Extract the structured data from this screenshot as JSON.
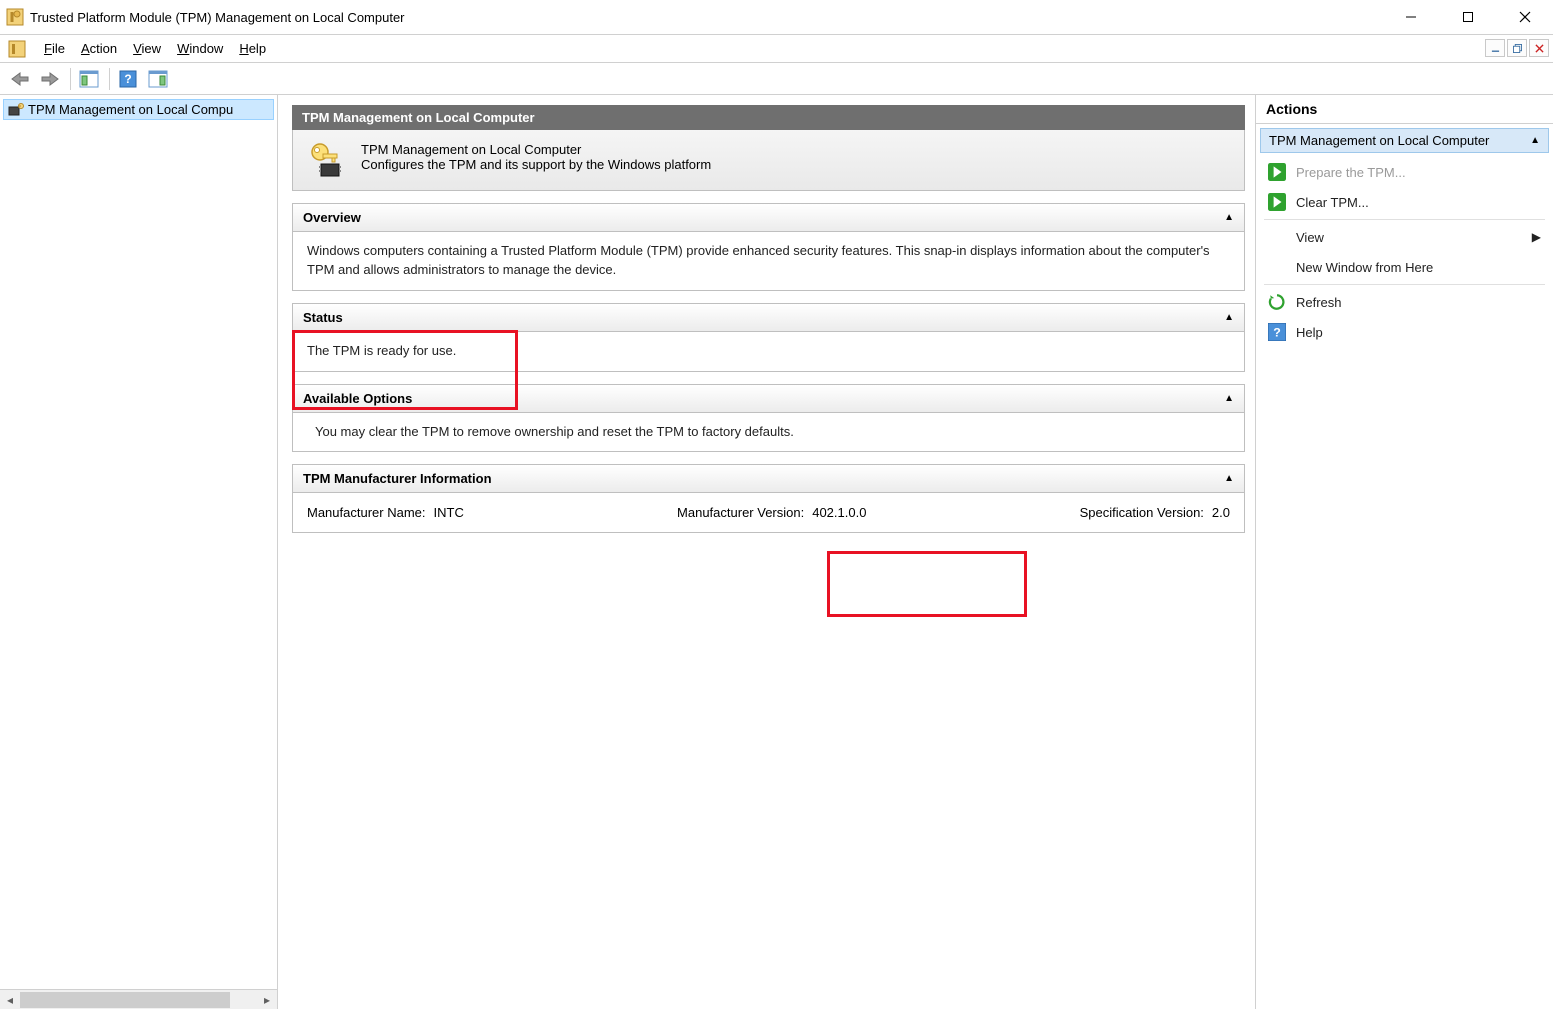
{
  "window": {
    "title": "Trusted Platform Module (TPM) Management on Local Computer"
  },
  "menu": {
    "file": "File",
    "action": "Action",
    "view": "View",
    "window": "Window",
    "help": "Help"
  },
  "tree": {
    "item": "TPM Management on Local Compu"
  },
  "content": {
    "header": "TPM Management on Local Computer",
    "intro_title": "TPM Management on Local Computer",
    "intro_desc": "Configures the TPM and its support by the Windows platform",
    "overview": {
      "title": "Overview",
      "body": "Windows computers containing a Trusted Platform Module (TPM) provide enhanced security features. This snap-in displays information about the computer's TPM and allows administrators to manage the device."
    },
    "status": {
      "title": "Status",
      "body": "The TPM is ready for use."
    },
    "options": {
      "title": "Available Options",
      "body": "You may clear the TPM to remove ownership and reset the TPM to factory defaults."
    },
    "mfr": {
      "title": "TPM Manufacturer Information",
      "name_label": "Manufacturer Name:",
      "name_value": "INTC",
      "ver_label": "Manufacturer Version:",
      "ver_value": "402.1.0.0",
      "spec_label": "Specification Version:",
      "spec_value": "2.0"
    }
  },
  "actions": {
    "title": "Actions",
    "group": "TPM Management on Local Computer",
    "prepare": "Prepare the TPM...",
    "clear": "Clear TPM...",
    "view": "View",
    "new_window": "New Window from Here",
    "refresh": "Refresh",
    "help": "Help"
  }
}
